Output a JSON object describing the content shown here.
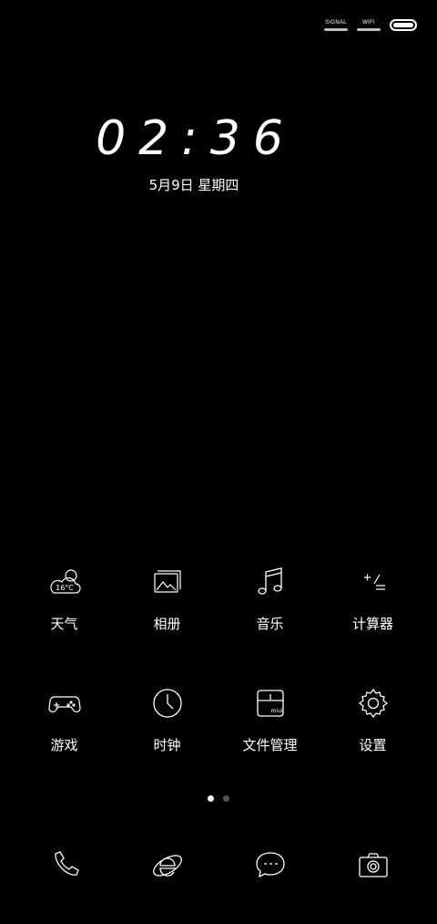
{
  "status_bar": {
    "signal_label": "SIGNAL",
    "wifi_label": "WIFI"
  },
  "lockscreen": {
    "time": "02:36",
    "date": "5月9日 星期四"
  },
  "apps": [
    {
      "label": "天气",
      "icon": "weather-icon",
      "badge": "16°C"
    },
    {
      "label": "相册",
      "icon": "gallery-icon"
    },
    {
      "label": "音乐",
      "icon": "music-icon"
    },
    {
      "label": "计算器",
      "icon": "calculator-icon"
    },
    {
      "label": "游戏",
      "icon": "gamepad-icon"
    },
    {
      "label": "时钟",
      "icon": "clock-icon"
    },
    {
      "label": "文件管理",
      "icon": "file-manager-icon",
      "badge": "miui"
    },
    {
      "label": "设置",
      "icon": "settings-icon"
    }
  ],
  "pager": {
    "pages": 2,
    "current": 1
  },
  "dock": [
    "phone-icon",
    "browser-icon",
    "messages-icon",
    "camera-icon"
  ],
  "colors": {
    "background": "#000000",
    "foreground": "#ffffff",
    "dot_inactive": "#555555"
  }
}
